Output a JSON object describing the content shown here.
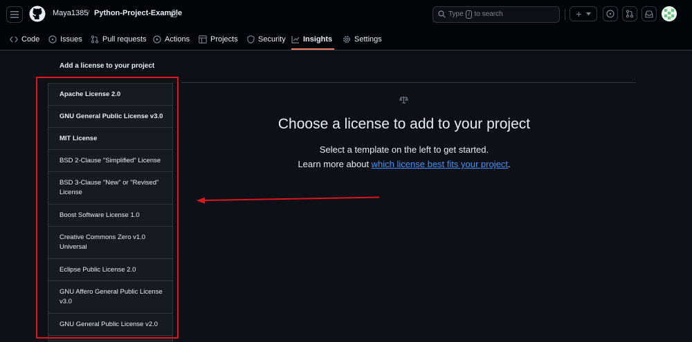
{
  "header": {
    "owner": "Maya1385",
    "separator": "/",
    "repo": "Python-Project-Example",
    "search": {
      "prefix": "Type",
      "key": "/",
      "suffix": "to search"
    },
    "new_button": "+"
  },
  "tabs": [
    {
      "label": "Code",
      "icon": "code-icon"
    },
    {
      "label": "Issues",
      "icon": "issue-icon"
    },
    {
      "label": "Pull requests",
      "icon": "pull-request-icon"
    },
    {
      "label": "Actions",
      "icon": "play-icon"
    },
    {
      "label": "Projects",
      "icon": "table-icon"
    },
    {
      "label": "Security",
      "icon": "shield-icon"
    },
    {
      "label": "Insights",
      "icon": "graph-icon",
      "active": true
    },
    {
      "label": "Settings",
      "icon": "gear-icon"
    }
  ],
  "page": {
    "section_title": "Add a license to your project",
    "licenses": [
      {
        "label": "Apache License 2.0",
        "bold": true
      },
      {
        "label": "GNU General Public License v3.0",
        "bold": true
      },
      {
        "label": "MIT License",
        "bold": true
      },
      {
        "label": "BSD 2-Clause \"Simplified\" License"
      },
      {
        "label": "BSD 3-Clause \"New\" or \"Revised\" License"
      },
      {
        "label": "Boost Software License 1.0"
      },
      {
        "label": "Creative Commons Zero v1.0 Universal"
      },
      {
        "label": "Eclipse Public License 2.0"
      },
      {
        "label": "GNU Affero General Public License v3.0"
      },
      {
        "label": "GNU General Public License v2.0"
      }
    ],
    "heading": "Choose a license to add to your project",
    "sub_line1": "Select a template on the left to get started.",
    "sub_line2_prefix": "Learn more about ",
    "sub_link": "which license best fits your project",
    "sub_line2_suffix": "."
  },
  "colors": {
    "accent_tab": "#f78166",
    "link": "#4493f8",
    "annotation": "#e0141a"
  }
}
